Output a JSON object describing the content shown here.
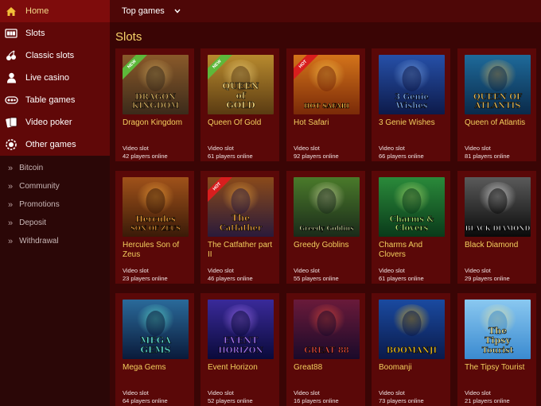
{
  "sidebar": {
    "menu": [
      {
        "label": "Home",
        "icon": "home-icon",
        "active": true
      },
      {
        "label": "Slots",
        "icon": "slot-machine-icon"
      },
      {
        "label": "Classic slots",
        "icon": "cherries-icon"
      },
      {
        "label": "Live casino",
        "icon": "dealer-icon"
      },
      {
        "label": "Table games",
        "icon": "roulette-table-icon"
      },
      {
        "label": "Video poker",
        "icon": "cards-icon"
      },
      {
        "label": "Other games",
        "icon": "chip-icon"
      }
    ],
    "links": [
      {
        "label": "Bitcoin"
      },
      {
        "label": "Community"
      },
      {
        "label": "Promotions"
      },
      {
        "label": "Deposit"
      },
      {
        "label": "Withdrawal"
      }
    ]
  },
  "topbar": {
    "dropdown_label": "Top games"
  },
  "section": {
    "title": "Slots"
  },
  "games": [
    {
      "name": "Dragon Kingdom",
      "type": "Video slot",
      "online": "42 players online",
      "badge": "NEW",
      "art": [
        "DRAGON",
        "KINGDOM"
      ],
      "colors": [
        "#3b2a1a",
        "#8a5a2a",
        "#c9a45a"
      ]
    },
    {
      "name": "Queen Of Gold",
      "type": "Video slot",
      "online": "61 players online",
      "badge": "NEW",
      "art": [
        "QUEEN",
        "of",
        "GOLD"
      ],
      "colors": [
        "#5a3b12",
        "#b88a2e",
        "#f0d27a"
      ]
    },
    {
      "name": "Hot Safari",
      "type": "Video slot",
      "online": "92 players online",
      "badge": "HOT",
      "art": [
        "HOT SAFARI"
      ],
      "colors": [
        "#7a2a08",
        "#d4741a",
        "#f6c24a"
      ]
    },
    {
      "name": "3 Genie Wishes",
      "type": "Video slot",
      "online": "66 players online",
      "badge": "",
      "art": [
        "3 Genie",
        "Wishes"
      ],
      "colors": [
        "#0d1a4a",
        "#2650a8",
        "#7aa6e8"
      ]
    },
    {
      "name": "Queen of Atlantis",
      "type": "Video slot",
      "online": "81 players online",
      "badge": "",
      "art": [
        "QUEEN OF",
        "ATLANTIS"
      ],
      "colors": [
        "#0a2a4a",
        "#1e6a9a",
        "#e0b85a"
      ]
    },
    {
      "name": "Hercules Son of Zeus",
      "type": "Video slot",
      "online": "23 players online",
      "badge": "",
      "art": [
        "Hercules",
        "SON OF ZEUS"
      ],
      "colors": [
        "#3a1a08",
        "#a0521a",
        "#f0a23a"
      ]
    },
    {
      "name": "The Catfather part II",
      "type": "Video slot",
      "online": "46 players online",
      "badge": "HOT",
      "art": [
        "The",
        "Catfather"
      ],
      "colors": [
        "#2a1a3a",
        "#8a4a1a",
        "#e6a03a"
      ]
    },
    {
      "name": "Greedy Goblins",
      "type": "Video slot",
      "online": "55 players online",
      "badge": "",
      "art": [
        "Greedy Goblins"
      ],
      "colors": [
        "#1a2a1a",
        "#4a7a2a",
        "#cfd8a0"
      ]
    },
    {
      "name": "Charms And Clovers",
      "type": "Video slot",
      "online": "61 players online",
      "badge": "",
      "art": [
        "Charms &",
        "Clovers"
      ],
      "colors": [
        "#0a3a1a",
        "#2a8a3a",
        "#b0e070"
      ]
    },
    {
      "name": "Black Diamond",
      "type": "Video slot",
      "online": "29 players online",
      "badge": "",
      "art": [
        "BLACK DIAMOND"
      ],
      "colors": [
        "#0a0a0a",
        "#5a5a5a",
        "#e8e8e8"
      ]
    },
    {
      "name": "Mega Gems",
      "type": "Video slot",
      "online": "64 players online",
      "badge": "",
      "art": [
        "MEGA",
        "GEMS"
      ],
      "colors": [
        "#0a1a3a",
        "#2a6a9a",
        "#60e0d0"
      ]
    },
    {
      "name": "Event Horizon",
      "type": "Video slot",
      "online": "52 players online",
      "badge": "",
      "art": [
        "EVENT",
        "HORIZON"
      ],
      "colors": [
        "#0a0a3a",
        "#3a2a9a",
        "#a070f0"
      ]
    },
    {
      "name": "Great88",
      "type": "Video slot",
      "online": "16 players online",
      "badge": "",
      "art": [
        "GREAT 88"
      ],
      "colors": [
        "#1a0a2a",
        "#6a1a3a",
        "#e04a3a"
      ]
    },
    {
      "name": "Boomanji",
      "type": "Video slot",
      "online": "73 players online",
      "badge": "",
      "art": [
        "BOOMANJI"
      ],
      "colors": [
        "#0a1a4a",
        "#1a4aa0",
        "#f0c020"
      ]
    },
    {
      "name": "The Tipsy Tourist",
      "type": "Video slot",
      "online": "21 players online",
      "badge": "",
      "art": [
        "The",
        "Tipsy",
        "Tourist"
      ],
      "colors": [
        "#3a8ad0",
        "#8ac8f0",
        "#f0e8a0"
      ]
    }
  ]
}
